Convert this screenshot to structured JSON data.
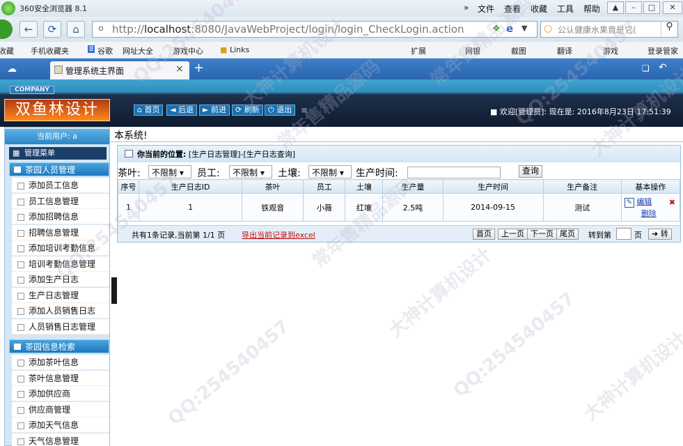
{
  "browser": {
    "title": "360安全浏览器 8.1",
    "menus": [
      "»",
      "文件",
      "查看",
      "收藏",
      "工具",
      "帮助"
    ],
    "url_prefix": "http://",
    "url_host": "localhost",
    "url_rest": ":8080/JavaWebProject/login/login_CheckLogin.action",
    "search_text": "公认健康水果竟是它(",
    "bookmarks_left": [
      "收藏",
      "手机收藏夹",
      "谷歌",
      "网址大全",
      "游戏中心",
      "Links"
    ],
    "bookmarks_right": [
      "扩展",
      "网银",
      "截图",
      "翻译",
      "游戏",
      "登录管家"
    ],
    "tab_title": "管理系统主界面",
    "tab_close": "×",
    "new_tab": "+"
  },
  "app": {
    "company_badge": "COMPANY",
    "logo_text": "双鱼林设计",
    "toolbar": [
      "首页",
      "后退",
      "前进",
      "刷新",
      "退出"
    ],
    "welcome": "欢迎[管理员]:  现在是: 2016年8月23日 17:51:39"
  },
  "sidebar": {
    "current_user": "当前用户: a",
    "menu_header": "管理菜单",
    "section1": "茶园人员管理",
    "section1_items": [
      "添加员工信息",
      "员工信息管理",
      "添加招聘信息",
      "招聘信息管理",
      "添加培训考勤信息",
      "培训考勤信息管理",
      "添加生产日志",
      "生产日志管理",
      "添加人员销售日志",
      "人员销售日志管理"
    ],
    "section2": "茶园信息检索",
    "section2_items": [
      "添加茶叶信息",
      "茶叶信息管理",
      "添加供应商",
      "供应商管理",
      "添加天气信息",
      "天气信息管理"
    ]
  },
  "main": {
    "top_text": "本系统!",
    "position_label": "你当前的位置:",
    "position_path": "[生产日志管理]-[生产日志查询]",
    "filter_tea_label": "茶叶:",
    "filter_tea_value": "不限制",
    "filter_staff_label": "员工:",
    "filter_staff_value": "不限制",
    "filter_soil_label": "土壤:",
    "filter_soil_value": "不限制",
    "filter_time_label": "生产时间:",
    "query_button": "查询",
    "columns": [
      "序号",
      "生产日志ID",
      "茶叶",
      "员工",
      "土壤",
      "生产量",
      "生产时间",
      "生产备注",
      "基本操作"
    ],
    "row": {
      "no": "1",
      "id": "1",
      "tea": "铁观音",
      "staff": "小薇",
      "soil": "红壤",
      "amount": "2.5吨",
      "time": "2014-09-15",
      "note": "测试",
      "edit": "编辑",
      "delete": "删除"
    },
    "pager_summary": "共有1条记录,当前第 1/1 页",
    "export_link": "导出当前记录到excel",
    "pager_buttons": [
      "首页",
      "上一页",
      "下一页",
      "尾页"
    ],
    "goto_label": "转到第",
    "page_unit": "页",
    "goto_button": "转"
  },
  "watermarks": [
    "QQ:254540457",
    "大神计算机设计",
    "常年售精品源码",
    "QQ:254540457",
    "大神计算机设计",
    "常年售精品源码",
    "QQ:254540457",
    "常年售精品源码",
    "大神计算机设计",
    "QQ:254540457",
    "QQ:254540457",
    "大神计算机设计"
  ]
}
